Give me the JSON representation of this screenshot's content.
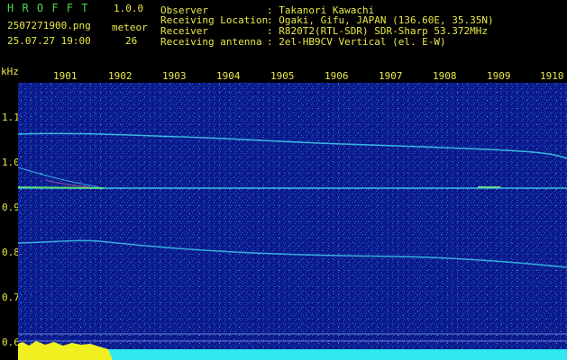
{
  "header": {
    "app_title": "H R O F F T",
    "version": "1.0.0",
    "filename": "2507271900.png",
    "datetime": "25.07.27 19:00",
    "meteor_label": "meteor",
    "meteor_count": "26",
    "info_labels": [
      "Observer",
      "Receiving Location",
      "Receiver",
      "Receiving antenna"
    ],
    "info_values": [
      ": Takanori Kawachi",
      ": Ogaki, Gifu, JAPAN (136.60E, 35.35N)",
      ": R820T2(RTL-SDR) SDR-Sharp 53.372MHz",
      ": 2el-HB9CV Vertical (el. E-W)"
    ]
  },
  "axis": {
    "y_unit": "kHz",
    "x_ticks": [
      "1901",
      "1902",
      "1903",
      "1904",
      "1905",
      "1906",
      "1907",
      "1908",
      "1909",
      "1910"
    ],
    "y_ticks": [
      "1.1",
      "1.0",
      "0.9",
      "0.8",
      "0.7",
      "0.6"
    ]
  },
  "colors": {
    "header_green": "#4cd84c",
    "label_yellow": "#e8e84a",
    "background_blue": "#0a1a8a",
    "trace_cyan": "#40c8e8",
    "level_yellow": "#f0f020"
  }
}
